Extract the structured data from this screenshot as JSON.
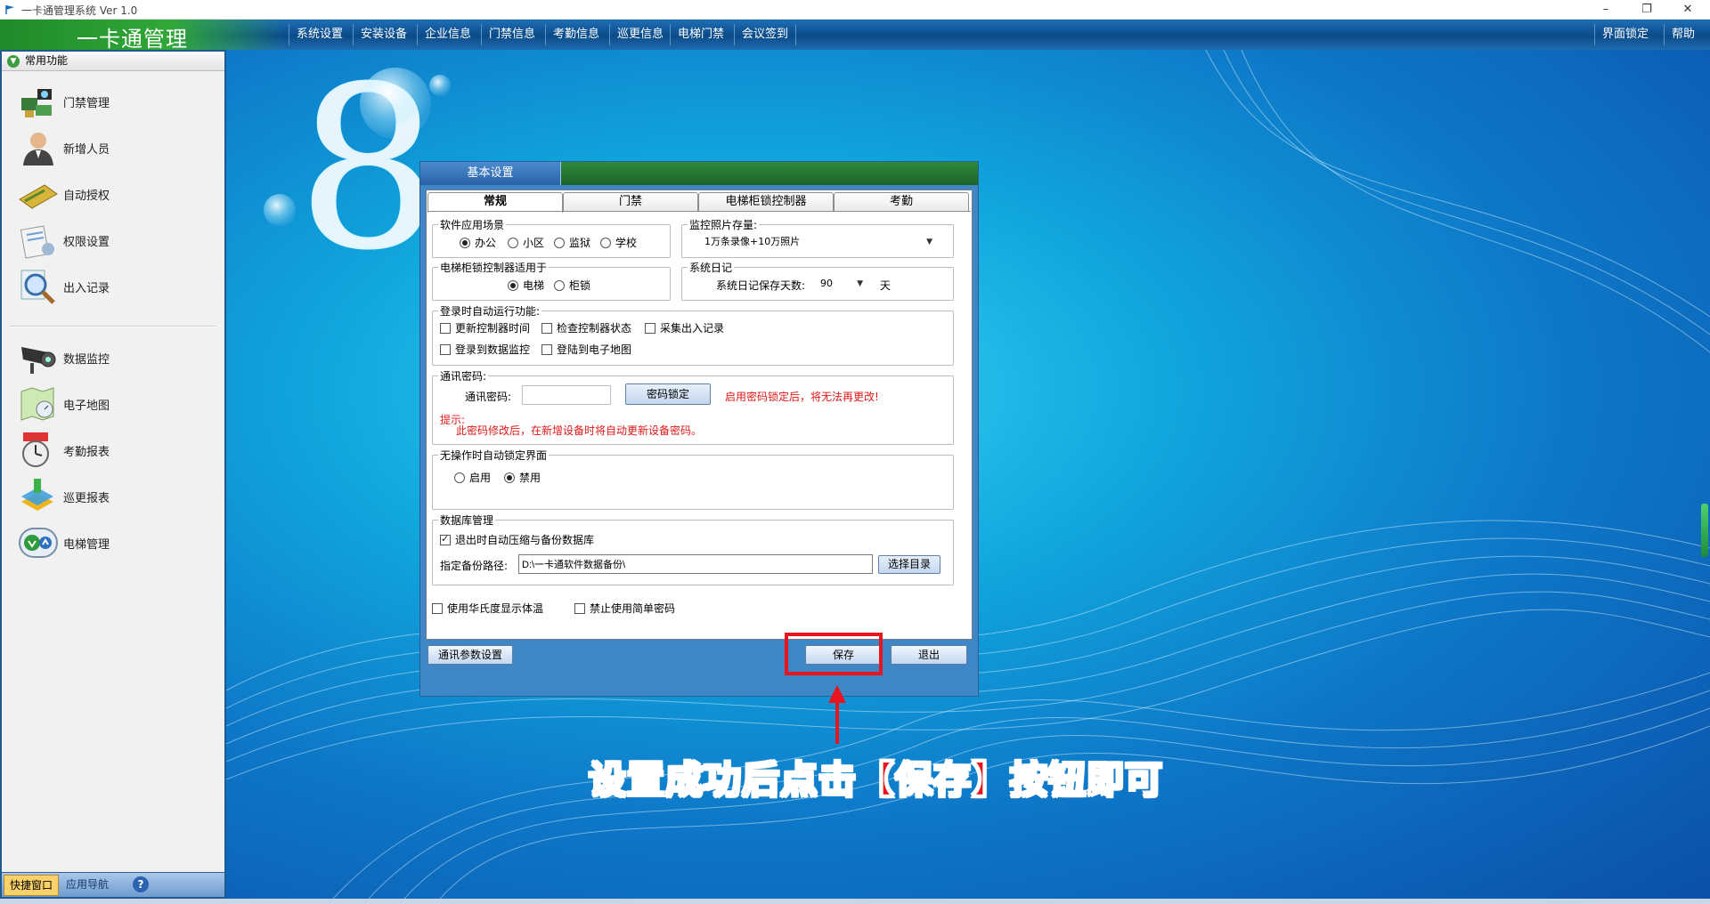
{
  "window": {
    "title": "一卡通管理系统 Ver 1.0",
    "minimize": "–",
    "restore": "❐",
    "close": "✕"
  },
  "menubar": {
    "brand": "一卡通管理",
    "items": [
      "系统设置",
      "安装设备",
      "企业信息",
      "门禁信息",
      "考勤信息",
      "巡更信息",
      "电梯门禁",
      "会议签到"
    ],
    "right_items": [
      "界面锁定",
      "帮助"
    ]
  },
  "left_panel": {
    "header": "常用功能",
    "items": [
      {
        "label": "门禁管理",
        "icon": "access-control-icon"
      },
      {
        "label": "新增人员",
        "icon": "person-icon"
      },
      {
        "label": "自动授权",
        "icon": "card-icon"
      },
      {
        "label": "权限设置",
        "icon": "permission-doc-icon"
      },
      {
        "label": "出入记录",
        "icon": "magnifier-icon"
      },
      {
        "label": "数据监控",
        "icon": "camera-icon"
      },
      {
        "label": "电子地图",
        "icon": "map-icon"
      },
      {
        "label": "考勤报表",
        "icon": "clock-icon"
      },
      {
        "label": "巡更报表",
        "icon": "patrol-icon"
      },
      {
        "label": "电梯管理",
        "icon": "elevator-icon"
      }
    ],
    "footer_tabs": [
      "快捷窗口",
      "应用导航"
    ],
    "help_icon": "?"
  },
  "dialog": {
    "title": "基本设置",
    "tabs": [
      "常规",
      "门禁",
      "电梯柜锁控制器",
      "考勤"
    ],
    "scene_group": {
      "title": "软件应用场景",
      "options": [
        "办公",
        "小区",
        "监狱",
        "学校"
      ],
      "selected": "办公"
    },
    "photo_group": {
      "title": "监控照片存量:",
      "value": "1万条录像+10万照片"
    },
    "cabinet_group": {
      "title": "电梯柜锁控制器适用于",
      "options": [
        "电梯",
        "柜锁"
      ],
      "selected": "电梯"
    },
    "log_group": {
      "title": "系统日记",
      "label": "系统日记保存天数:",
      "value": "90",
      "unit": "天"
    },
    "autorun_group": {
      "title": "登录时自动运行功能:",
      "checks": [
        "更新控制器时间",
        "检查控制器状态",
        "采集出入记录",
        "登录到数据监控",
        "登陆到电子地图"
      ]
    },
    "comm_group": {
      "title": "通讯密码:",
      "label": "通讯密码:",
      "value": "",
      "lock_button": "密码锁定",
      "warning": "启用密码锁定后，将无法再更改!",
      "tip_label": "提示:",
      "tip_text": "此密码修改后，在新增设备时将自动更新设备密码。"
    },
    "idle_group": {
      "title": "无操作时自动锁定界面",
      "options": [
        "启用",
        "禁用"
      ],
      "selected": "禁用"
    },
    "db_group": {
      "title": "数据库管理",
      "auto_backup": "退出时自动压缩与备份数据库",
      "path_label": "指定备份路径:",
      "path_value": "D:\\一卡通软件数据备份\\",
      "browse_button": "选择目录"
    },
    "bottom_checks": [
      "使用华氏度显示体温",
      "禁止使用简单密码"
    ],
    "comm_params_button": "通讯参数设置",
    "save_button": "保存",
    "exit_button": "退出"
  },
  "annotation": "设置成功后点击【保存】按钮即可",
  "colors": {
    "accent_red": "#e8141e",
    "menubar_blue": "#0d4f8f",
    "brand_green": "#31a838"
  }
}
